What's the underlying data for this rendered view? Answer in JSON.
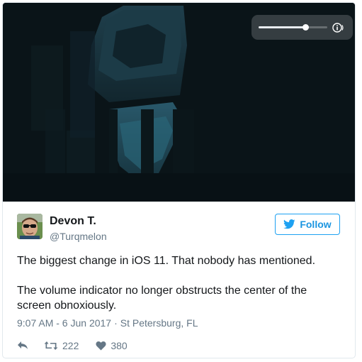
{
  "media": {
    "volume_level": 0.68,
    "icon": "volume-icon"
  },
  "author": {
    "display_name": "Devon T.",
    "handle": "@Turqmelon",
    "avatar_icon": "avatar"
  },
  "follow_button": {
    "label": "Follow",
    "icon": "twitter-bird-icon",
    "color": "#1da1f2"
  },
  "tweet": {
    "paragraphs": [
      "The biggest change in iOS 11. That nobody has mentioned.",
      "The volume indicator no longer obstructs the center of the screen obnoxiously."
    ],
    "time": "9:07 AM - 6 Jun 2017",
    "separator": "·",
    "location": "St Petersburg, FL"
  },
  "actions": {
    "reply_icon": "reply-icon",
    "retweet_icon": "retweet-icon",
    "retweet_count": "222",
    "like_icon": "heart-icon",
    "like_count": "380"
  }
}
